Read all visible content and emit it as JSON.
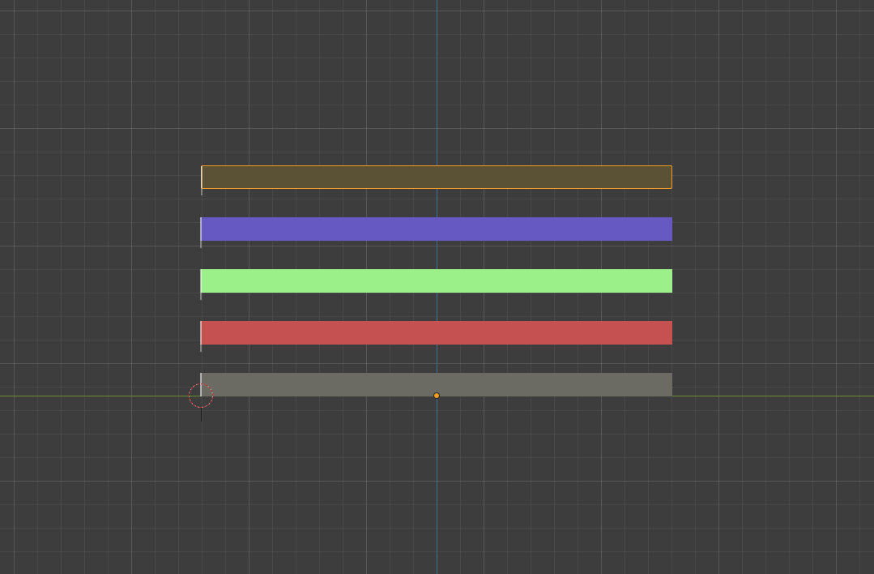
{
  "viewport": {
    "name": "sequencer-preview-viewport",
    "colors": {
      "background": "#3d3d3d",
      "x_axis": "#6a8f2e",
      "y_axis": "#3f6d9e",
      "selection_outline": "#f29b25",
      "origin": "#f29b25"
    }
  },
  "strips": [
    {
      "name": "strip-olive",
      "color": "#5b5236",
      "selected": true
    },
    {
      "name": "strip-blue",
      "color": "#665ac2",
      "selected": false
    },
    {
      "name": "strip-green",
      "color": "#9bf08a",
      "selected": false
    },
    {
      "name": "strip-red",
      "color": "#c55250",
      "selected": false
    },
    {
      "name": "strip-gray",
      "color": "#6b6b63",
      "selected": false
    }
  ],
  "cursor": {
    "icon": "3d-cursor-icon"
  },
  "origin": {
    "icon": "object-origin-dot"
  }
}
